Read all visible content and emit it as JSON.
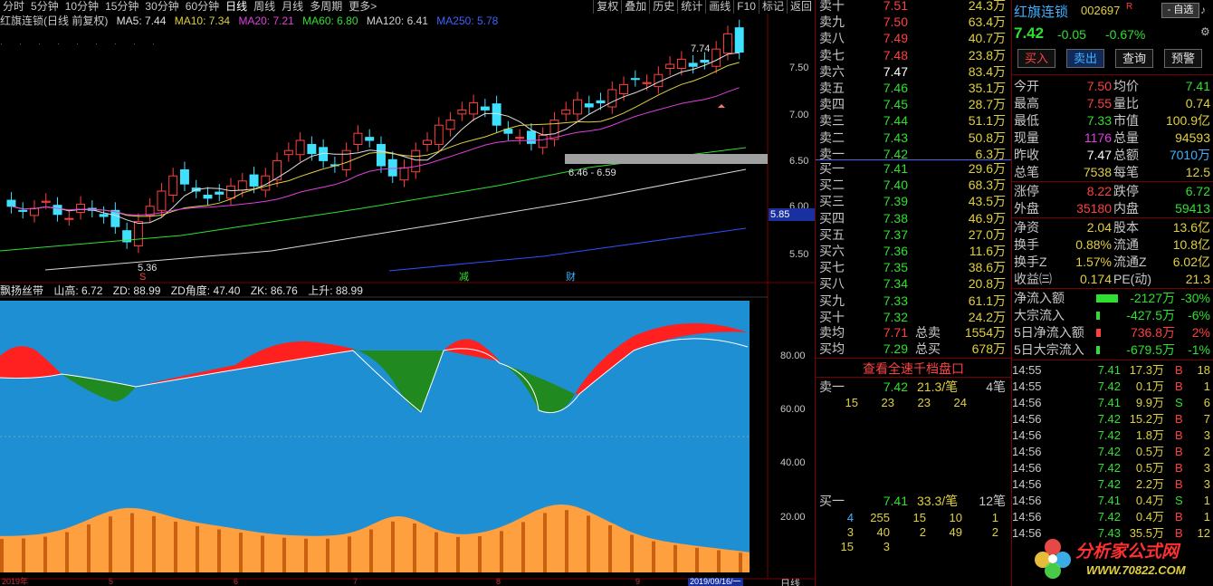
{
  "toolbar": {
    "periods": [
      "分时",
      "5分钟",
      "10分钟",
      "15分钟",
      "30分钟",
      "60分钟",
      "日线",
      "周线",
      "月线",
      "多周期",
      "更多>"
    ],
    "active": "日线",
    "right_buttons": [
      "复权",
      "叠加",
      "历史",
      "统计",
      "画线",
      "F10",
      "标记",
      "返回"
    ]
  },
  "chart_header": {
    "title": "红旗连锁(日线 前复权)",
    "ma5": "MA5: 7.44",
    "ma10": "MA10: 7.34",
    "ma20": "MA20: 7.21",
    "ma60": "MA60: 6.80",
    "ma120": "MA120: 6.41",
    "ma250": "MA250: 5.78"
  },
  "price_axis": [
    "7.50",
    "7.00",
    "6.50",
    "6.00",
    "5.50"
  ],
  "price_tag": "5.85",
  "annotations": {
    "high_label": "7.74",
    "low_label": "5.36",
    "range_label": "6.46 - 6.59",
    "mark_s": "S",
    "mark_jian": "减",
    "mark_cai": "财"
  },
  "indicator_header": {
    "name": "飘扬丝带",
    "shangao": "山高: 6.72",
    "zd": "ZD: 88.99",
    "zd_angle": "ZD角度: 47.40",
    "zk": "ZK: 86.76",
    "shangsheng": "上升: 88.99"
  },
  "indicator_axis": [
    "80.00",
    "60.00",
    "40.00",
    "20.00"
  ],
  "date_axis": [
    "2019年",
    "5",
    "6",
    "7",
    "8",
    "9"
  ],
  "date_selected": "2019/09/16/一",
  "period_label": "日线",
  "stock": {
    "name": "红旗连锁",
    "code": "002697",
    "flag": "R",
    "price": "7.42",
    "change": "-0.05",
    "pct": "-0.67%",
    "self_select": "- 自选"
  },
  "actions": [
    "买入",
    "卖出",
    "查询",
    "预警"
  ],
  "order_book": {
    "sells": [
      {
        "label": "卖十",
        "price": "7.51",
        "vol": "24.3万"
      },
      {
        "label": "卖九",
        "price": "7.50",
        "vol": "63.4万"
      },
      {
        "label": "卖八",
        "price": "7.49",
        "vol": "40.7万"
      },
      {
        "label": "卖七",
        "price": "7.48",
        "vol": "23.8万"
      },
      {
        "label": "卖六",
        "price": "7.47",
        "vol": "83.4万"
      },
      {
        "label": "卖五",
        "price": "7.46",
        "vol": "35.1万"
      },
      {
        "label": "卖四",
        "price": "7.45",
        "vol": "28.7万"
      },
      {
        "label": "卖三",
        "price": "7.44",
        "vol": "51.1万"
      },
      {
        "label": "卖二",
        "price": "7.43",
        "vol": "50.8万"
      },
      {
        "label": "卖一",
        "price": "7.42",
        "vol": "6.3万"
      }
    ],
    "buys": [
      {
        "label": "买一",
        "price": "7.41",
        "vol": "29.6万"
      },
      {
        "label": "买二",
        "price": "7.40",
        "vol": "68.3万"
      },
      {
        "label": "买三",
        "price": "7.39",
        "vol": "43.5万"
      },
      {
        "label": "买四",
        "price": "7.38",
        "vol": "46.9万"
      },
      {
        "label": "买五",
        "price": "7.37",
        "vol": "27.0万"
      },
      {
        "label": "买六",
        "price": "7.36",
        "vol": "11.6万"
      },
      {
        "label": "买七",
        "price": "7.35",
        "vol": "38.6万"
      },
      {
        "label": "买八",
        "price": "7.34",
        "vol": "20.8万"
      },
      {
        "label": "买九",
        "price": "7.33",
        "vol": "61.1万"
      },
      {
        "label": "买十",
        "price": "7.32",
        "vol": "24.2万"
      }
    ],
    "sell_avg": {
      "label": "卖均",
      "price": "7.71",
      "tlabel": "总卖",
      "tval": "1554万"
    },
    "buy_avg": {
      "label": "买均",
      "price": "7.29",
      "tlabel": "总买",
      "tval": "678万"
    },
    "full_depth": "查看全速千档盘口",
    "sell1_detail": {
      "label": "卖一",
      "price": "7.42",
      "per": "21.3/笔",
      "count": "4笔",
      "queue": [
        "15",
        "23",
        "23",
        "24"
      ]
    },
    "buy1_detail": {
      "label": "买一",
      "price": "7.41",
      "per": "33.3/笔",
      "count": "12笔",
      "queue": [
        [
          "4",
          "255",
          "15",
          "10",
          "1"
        ],
        [
          "3",
          "40",
          "2",
          "49",
          "2"
        ],
        [
          "15",
          "3",
          "",
          "",
          ""
        ]
      ]
    }
  },
  "quote": [
    {
      "l1": "今开",
      "v1": "7.50",
      "l2": "均价",
      "v2": "7.41"
    },
    {
      "l1": "最高",
      "v1": "7.55",
      "l2": "量比",
      "v2": "0.74"
    },
    {
      "l1": "最低",
      "v1": "7.33",
      "l2": "市值",
      "v2": "100.9亿"
    },
    {
      "l1": "现量",
      "v1": "1176",
      "l2": "总量",
      "v2": "94593"
    },
    {
      "l1": "昨收",
      "v1": "7.47",
      "l2": "总额",
      "v2": "7010万"
    },
    {
      "l1": "总笔",
      "v1": "7538",
      "l2": "每笔",
      "v2": "12.5"
    },
    {
      "l1": "涨停",
      "v1": "8.22",
      "l2": "跌停",
      "v2": "6.72"
    },
    {
      "l1": "外盘",
      "v1": "35180",
      "l2": "内盘",
      "v2": "59413"
    },
    {
      "l1": "净资",
      "v1": "2.04",
      "l2": "股本",
      "v2": "13.6亿"
    },
    {
      "l1": "换手",
      "v1": "0.88%",
      "l2": "流通",
      "v2": "10.8亿"
    },
    {
      "l1": "换手Z",
      "v1": "1.57%",
      "l2": "流通Z",
      "v2": "6.02亿"
    },
    {
      "l1": "收益㈢",
      "v1": "0.174",
      "l2": "PE(动)",
      "v2": "21.3"
    }
  ],
  "flows": [
    {
      "label": "净流入额",
      "val": "-2127万",
      "pct": "-30%",
      "bar": 1.0
    },
    {
      "label": "大宗流入",
      "val": "-427.5万",
      "pct": "-6%",
      "bar": 0.12
    },
    {
      "label": "5日净流入额",
      "val": "736.8万",
      "pct": "2%",
      "bar": 0.2
    },
    {
      "label": "5日大宗流入",
      "val": "-679.5万",
      "pct": "-1%",
      "bar": 0.12
    }
  ],
  "ticks": [
    {
      "t": "14:55",
      "p": "7.41",
      "v": "17.3万",
      "d": "B",
      "n": "18"
    },
    {
      "t": "14:55",
      "p": "7.42",
      "v": "0.1万",
      "d": "B",
      "n": "1"
    },
    {
      "t": "14:56",
      "p": "7.41",
      "v": "9.9万",
      "d": "S",
      "n": "6"
    },
    {
      "t": "14:56",
      "p": "7.42",
      "v": "15.2万",
      "d": "B",
      "n": "7"
    },
    {
      "t": "14:56",
      "p": "7.42",
      "v": "1.8万",
      "d": "B",
      "n": "3"
    },
    {
      "t": "14:56",
      "p": "7.42",
      "v": "0.5万",
      "d": "B",
      "n": "2"
    },
    {
      "t": "14:56",
      "p": "7.42",
      "v": "0.5万",
      "d": "B",
      "n": "3"
    },
    {
      "t": "14:56",
      "p": "7.42",
      "v": "2.2万",
      "d": "B",
      "n": "3"
    },
    {
      "t": "14:56",
      "p": "7.41",
      "v": "0.4万",
      "d": "S",
      "n": "1"
    },
    {
      "t": "14:56",
      "p": "7.42",
      "v": "0.4万",
      "d": "B",
      "n": "1"
    },
    {
      "t": "14:56",
      "p": "7.43",
      "v": "35.5万",
      "d": "B",
      "n": "12"
    }
  ],
  "watermark": {
    "title": "分析家公式网",
    "url": "WWW.70822.COM"
  },
  "chart_data": {
    "type": "candlestick",
    "series_names": [
      "MA5",
      "MA10",
      "MA20",
      "MA60",
      "MA120",
      "MA250"
    ],
    "close_path": [
      5.9,
      5.85,
      5.88,
      5.95,
      5.82,
      5.78,
      5.92,
      5.86,
      5.8,
      5.7,
      5.55,
      5.75,
      5.9,
      6.05,
      6.2,
      6.12,
      6.05,
      5.98,
      6.02,
      6.1,
      6.15,
      6.1,
      6.2,
      6.35,
      6.45,
      6.55,
      6.42,
      6.35,
      6.3,
      6.45,
      6.62,
      6.55,
      6.3,
      6.2,
      6.28,
      6.45,
      6.55,
      6.7,
      6.75,
      6.85,
      6.92,
      6.85,
      6.7,
      6.62,
      6.58,
      6.52,
      6.6,
      6.75,
      6.85,
      6.95,
      6.88,
      6.92,
      7.05,
      7.1,
      7.15,
      7.12,
      7.2,
      7.3,
      7.35,
      7.28,
      7.32,
      7.45,
      7.6,
      7.42
    ],
    "price_range": [
      5.3,
      7.8
    ]
  }
}
